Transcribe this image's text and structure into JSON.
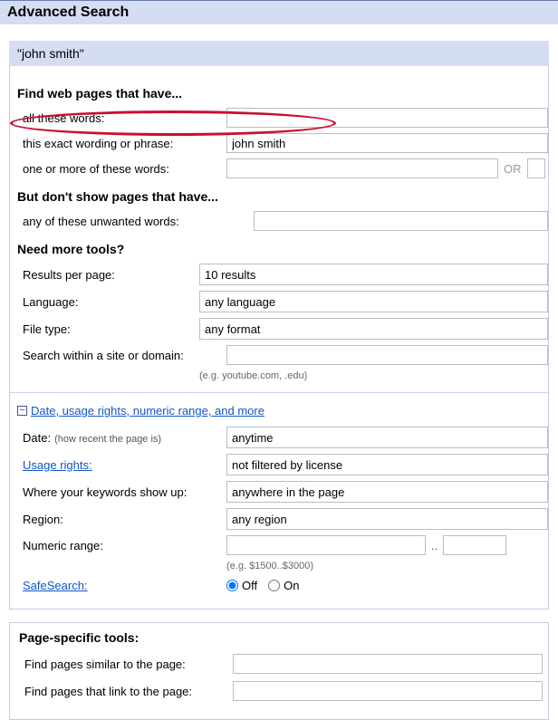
{
  "title": "Advanced Search",
  "query_display": "\"john smith\"",
  "find": {
    "heading": "Find web pages that have...",
    "all_words_label": "all these words:",
    "all_words_value": "",
    "exact_label": "this exact wording or phrase:",
    "exact_value": "john smith",
    "one_or_more_label": "one or more of these words:",
    "one_or_more_value": "",
    "or_text": "OR"
  },
  "exclude": {
    "heading": "But don't show pages that have...",
    "unwanted_label": "any of these unwanted words:",
    "unwanted_value": ""
  },
  "tools": {
    "heading": "Need more tools?",
    "results_label": "Results per page:",
    "results_value": "10 results",
    "language_label": "Language:",
    "language_value": "any language",
    "filetype_label": "File type:",
    "filetype_value": "any format",
    "site_label": "Search within a site or domain:",
    "site_value": "",
    "site_hint": "(e.g. youtube.com, .edu)"
  },
  "advanced": {
    "expander_label": "Date, usage rights, numeric range, and more",
    "date_label": "Date:",
    "date_sublabel": "(how recent the page is)",
    "date_value": "anytime",
    "usage_label": "Usage rights:",
    "usage_value": "not filtered by license",
    "where_label": "Where your keywords show up:",
    "where_value": "anywhere in the page",
    "region_label": "Region:",
    "region_value": "any region",
    "numeric_label": "Numeric range:",
    "numeric_low": "",
    "numeric_high": "",
    "numeric_sep": "..",
    "numeric_hint": "(e.g. $1500..$3000)",
    "safesearch_label": "SafeSearch:",
    "safesearch_off": "Off",
    "safesearch_on": "On"
  },
  "page_tools": {
    "heading": "Page-specific tools:",
    "similar_label": "Find pages similar to the page:",
    "similar_value": "",
    "link_label": "Find pages that link to the page:",
    "link_value": ""
  }
}
